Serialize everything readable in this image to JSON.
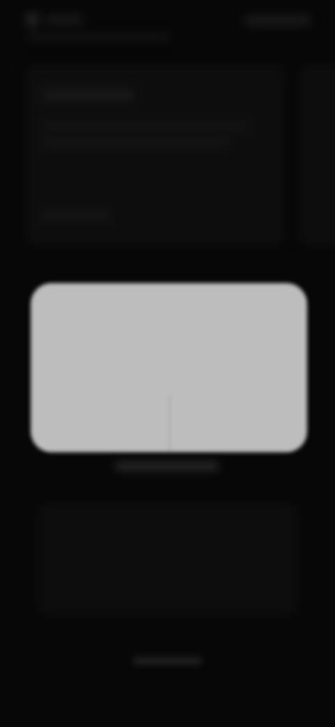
{
  "colors": {
    "background": "#0b0b0b",
    "dialog_surface": "#bdbdbd",
    "dialog_text": "#8a8a8a"
  },
  "dialog": {
    "title": "",
    "message": "",
    "cancel_label": "",
    "confirm_label": ""
  },
  "footer": {
    "link_text": ""
  }
}
